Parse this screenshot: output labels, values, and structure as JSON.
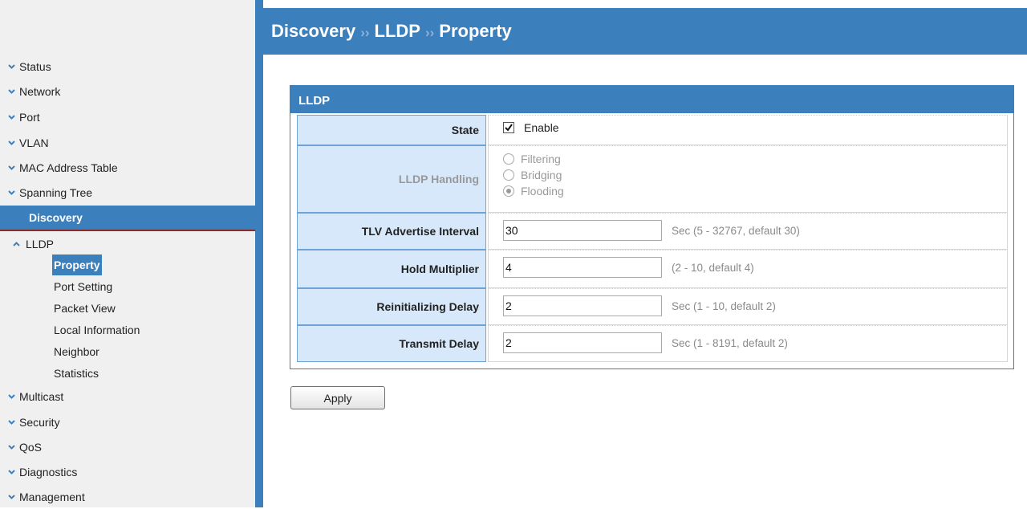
{
  "sidebar": {
    "items_top": [
      "Status",
      "Network",
      "Port",
      "VLAN",
      "MAC Address Table",
      "Spanning Tree"
    ],
    "active": "Discovery",
    "lldp": "LLDP",
    "lldp_sub": [
      "Property",
      "Port Setting",
      "Packet View",
      "Local Information",
      "Neighbor",
      "Statistics"
    ],
    "items_bottom": [
      "Multicast",
      "Security",
      "QoS",
      "Diagnostics",
      "Management"
    ]
  },
  "header": {
    "crumbs": [
      "Discovery",
      "LLDP",
      "Property"
    ],
    "separator": "››"
  },
  "panel": {
    "title": "LLDP",
    "state": {
      "label": "State",
      "checkbox_label": "Enable",
      "checked": true
    },
    "handling": {
      "label": "LLDP Handling",
      "options": [
        "Filtering",
        "Bridging",
        "Flooding"
      ],
      "selected": "Flooding"
    },
    "tlv_interval": {
      "label": "TLV Advertise Interval",
      "value": "30",
      "hint": "Sec (5 - 32767, default 30)"
    },
    "hold_multiplier": {
      "label": "Hold Multiplier",
      "value": "4",
      "hint": "(2 - 10, default 4)"
    },
    "reinit_delay": {
      "label": "Reinitializing Delay",
      "value": "2",
      "hint": "Sec (1 - 10, default 2)"
    },
    "transmit_delay": {
      "label": "Transmit Delay",
      "value": "2",
      "hint": "Sec (1 - 8191, default 2)"
    }
  },
  "apply_label": "Apply",
  "colors": {
    "accent": "#3b7fbd",
    "label_bg": "#d6e8f9",
    "hint": "#8a8a8a"
  }
}
